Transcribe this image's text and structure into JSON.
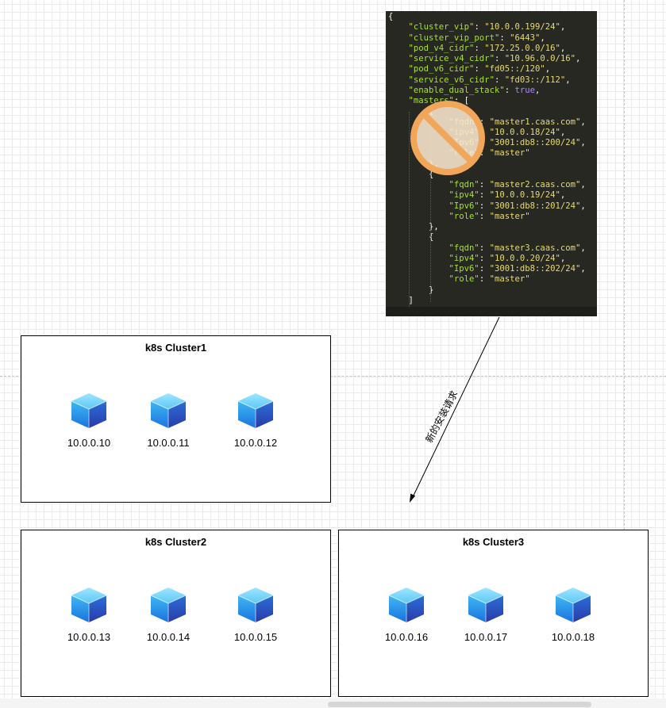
{
  "code_lines": [
    [
      [
        "p",
        "{"
      ]
    ],
    [
      [
        "p",
        "    "
      ],
      [
        "k",
        "\"cluster_vip\""
      ],
      [
        "p",
        ": "
      ],
      [
        "s",
        "\"10.0.0.199/24\""
      ],
      [
        "p",
        ","
      ]
    ],
    [
      [
        "p",
        "    "
      ],
      [
        "k",
        "\"cluster_vip_port\""
      ],
      [
        "p",
        ": "
      ],
      [
        "s",
        "\"6443\""
      ],
      [
        "p",
        ","
      ]
    ],
    [
      [
        "p",
        "    "
      ],
      [
        "k",
        "\"pod_v4_cidr\""
      ],
      [
        "p",
        ": "
      ],
      [
        "s",
        "\"172.25.0.0/16\""
      ],
      [
        "p",
        ","
      ]
    ],
    [
      [
        "p",
        "    "
      ],
      [
        "k",
        "\"service_v4_cidr\""
      ],
      [
        "p",
        ": "
      ],
      [
        "s",
        "\"10.96.0.0/16\""
      ],
      [
        "p",
        ","
      ]
    ],
    [
      [
        "p",
        "    "
      ],
      [
        "k",
        "\"pod_v6_cidr\""
      ],
      [
        "p",
        ": "
      ],
      [
        "s",
        "\"fd05::/120\""
      ],
      [
        "p",
        ","
      ]
    ],
    [
      [
        "p",
        "    "
      ],
      [
        "k",
        "\"service_v6_cidr\""
      ],
      [
        "p",
        ": "
      ],
      [
        "s",
        "\"fd03::/112\""
      ],
      [
        "p",
        ","
      ]
    ],
    [
      [
        "p",
        "    "
      ],
      [
        "k",
        "\"enable_dual_stack\""
      ],
      [
        "p",
        ": "
      ],
      [
        "b",
        "true"
      ],
      [
        "p",
        ","
      ]
    ],
    [
      [
        "p",
        "    "
      ],
      [
        "k",
        "\"masters\""
      ],
      [
        "p",
        ": ["
      ]
    ],
    [
      [
        "p",
        "        {"
      ]
    ],
    [
      [
        "p",
        "            "
      ],
      [
        "k",
        "\"fqdn\""
      ],
      [
        "p",
        ": "
      ],
      [
        "s",
        "\"master1.caas.com\""
      ],
      [
        "p",
        ","
      ]
    ],
    [
      [
        "p",
        "            "
      ],
      [
        "k",
        "\"ipv4\""
      ],
      [
        "p",
        ": "
      ],
      [
        "s",
        "\"10.0.0.18/24\""
      ],
      [
        "p",
        ","
      ]
    ],
    [
      [
        "p",
        "            "
      ],
      [
        "k",
        "\"Ipv6\""
      ],
      [
        "p",
        ": "
      ],
      [
        "s",
        "\"3001:db8::200/24\""
      ],
      [
        "p",
        ","
      ]
    ],
    [
      [
        "p",
        "            "
      ],
      [
        "k",
        "\"role\""
      ],
      [
        "p",
        ": "
      ],
      [
        "s",
        "\"master\""
      ]
    ],
    [
      [
        "p",
        "        },"
      ]
    ],
    [
      [
        "p",
        "        {"
      ]
    ],
    [
      [
        "p",
        "            "
      ],
      [
        "k",
        "\"fqdn\""
      ],
      [
        "p",
        ": "
      ],
      [
        "s",
        "\"master2.caas.com\""
      ],
      [
        "p",
        ","
      ]
    ],
    [
      [
        "p",
        "            "
      ],
      [
        "k",
        "\"ipv4\""
      ],
      [
        "p",
        ": "
      ],
      [
        "s",
        "\"10.0.0.19/24\""
      ],
      [
        "p",
        ","
      ]
    ],
    [
      [
        "p",
        "            "
      ],
      [
        "k",
        "\"Ipv6\""
      ],
      [
        "p",
        ": "
      ],
      [
        "s",
        "\"3001:db8::201/24\""
      ],
      [
        "p",
        ","
      ]
    ],
    [
      [
        "p",
        "            "
      ],
      [
        "k",
        "\"role\""
      ],
      [
        "p",
        ": "
      ],
      [
        "s",
        "\"master\""
      ]
    ],
    [
      [
        "p",
        "        },"
      ]
    ],
    [
      [
        "p",
        "        {"
      ]
    ],
    [
      [
        "p",
        "            "
      ],
      [
        "k",
        "\"fqdn\""
      ],
      [
        "p",
        ": "
      ],
      [
        "s",
        "\"master3.caas.com\""
      ],
      [
        "p",
        ","
      ]
    ],
    [
      [
        "p",
        "            "
      ],
      [
        "k",
        "\"ipv4\""
      ],
      [
        "p",
        ": "
      ],
      [
        "s",
        "\"10.0.0.20/24\""
      ],
      [
        "p",
        ","
      ]
    ],
    [
      [
        "p",
        "            "
      ],
      [
        "k",
        "\"Ipv6\""
      ],
      [
        "p",
        ": "
      ],
      [
        "s",
        "\"3001:db8::202/24\""
      ],
      [
        "p",
        ","
      ]
    ],
    [
      [
        "p",
        "            "
      ],
      [
        "k",
        "\"role\""
      ],
      [
        "p",
        ": "
      ],
      [
        "s",
        "\"master\""
      ]
    ],
    [
      [
        "p",
        "        }"
      ]
    ],
    [
      [
        "p",
        "    ]"
      ]
    ],
    [
      [
        "p",
        "}"
      ]
    ]
  ],
  "arrow_label": "新的安装请求",
  "clusters": [
    {
      "title": "k8s Cluster1",
      "nodes": [
        "10.0.0.10",
        "10.0.0.11",
        "10.0.0.12"
      ]
    },
    {
      "title": "k8s Cluster2",
      "nodes": [
        "10.0.0.13",
        "10.0.0.14",
        "10.0.0.15"
      ]
    },
    {
      "title": "k8s Cluster3",
      "nodes": [
        "10.0.0.16",
        "10.0.0.17",
        "10.0.0.18"
      ]
    }
  ],
  "icons": {
    "cube": "server-cube-icon",
    "prohibit": "prohibited-icon"
  },
  "colors": {
    "code_bg": "#272822",
    "code_key": "#a6e22e",
    "code_string": "#e6db74",
    "code_bool": "#ae81ff",
    "prohibit_orange": "#f2a65a",
    "prohibit_fill": "#fde8cf",
    "arrow": "#000000"
  }
}
